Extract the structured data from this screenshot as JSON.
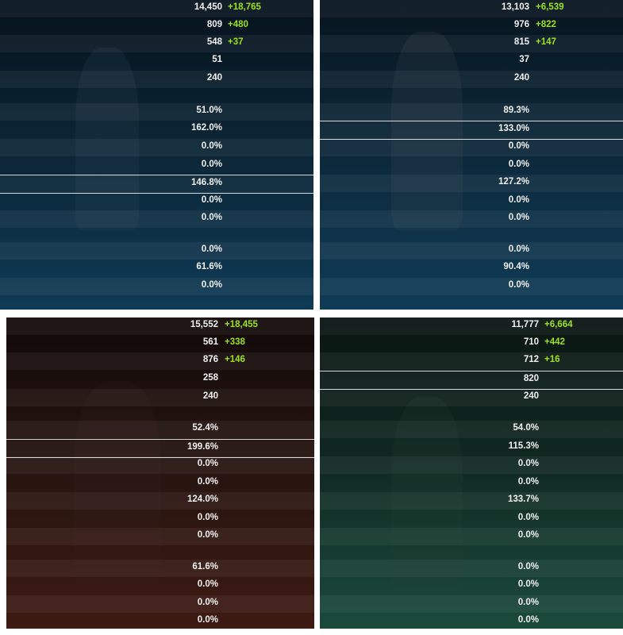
{
  "panels": [
    {
      "key": "tl",
      "values": [
        "14,450",
        "809",
        "548",
        "51",
        "240",
        "",
        "51.0%",
        "162.0%",
        "0.0%",
        "0.0%",
        "146.8%",
        "0.0%",
        "0.0%",
        "",
        "0.0%",
        "61.6%",
        "0.0%"
      ],
      "bonuses": [
        "+18,765",
        "+480",
        "+37"
      ],
      "highlight_row": 10
    },
    {
      "key": "tr",
      "values": [
        "13,103",
        "976",
        "815",
        "37",
        "240",
        "",
        "89.3%",
        "133.0%",
        "0.0%",
        "0.0%",
        "127.2%",
        "0.0%",
        "0.0%",
        "",
        "0.0%",
        "90.4%",
        "0.0%"
      ],
      "bonuses": [
        "+6,539",
        "+822",
        "+147"
      ],
      "highlight_row": 7
    },
    {
      "key": "bl",
      "values": [
        "15,552",
        "561",
        "876",
        "258",
        "240",
        "",
        "52.4%",
        "199.6%",
        "0.0%",
        "0.0%",
        "124.0%",
        "0.0%",
        "0.0%",
        "",
        "61.6%",
        "0.0%",
        "0.0%",
        "0.0%"
      ],
      "bonuses": [
        "+18,455",
        "+338",
        "+146"
      ],
      "highlight_row": 7
    },
    {
      "key": "br",
      "values": [
        "11,777",
        "710",
        "712",
        "820",
        "240",
        "",
        "54.0%",
        "115.3%",
        "0.0%",
        "0.0%",
        "133.7%",
        "0.0%",
        "0.0%",
        "",
        "0.0%",
        "0.0%",
        "0.0%",
        "0.0%"
      ],
      "bonuses": [
        "+6,664",
        "+442",
        "+16"
      ],
      "highlight_row": 3
    }
  ]
}
